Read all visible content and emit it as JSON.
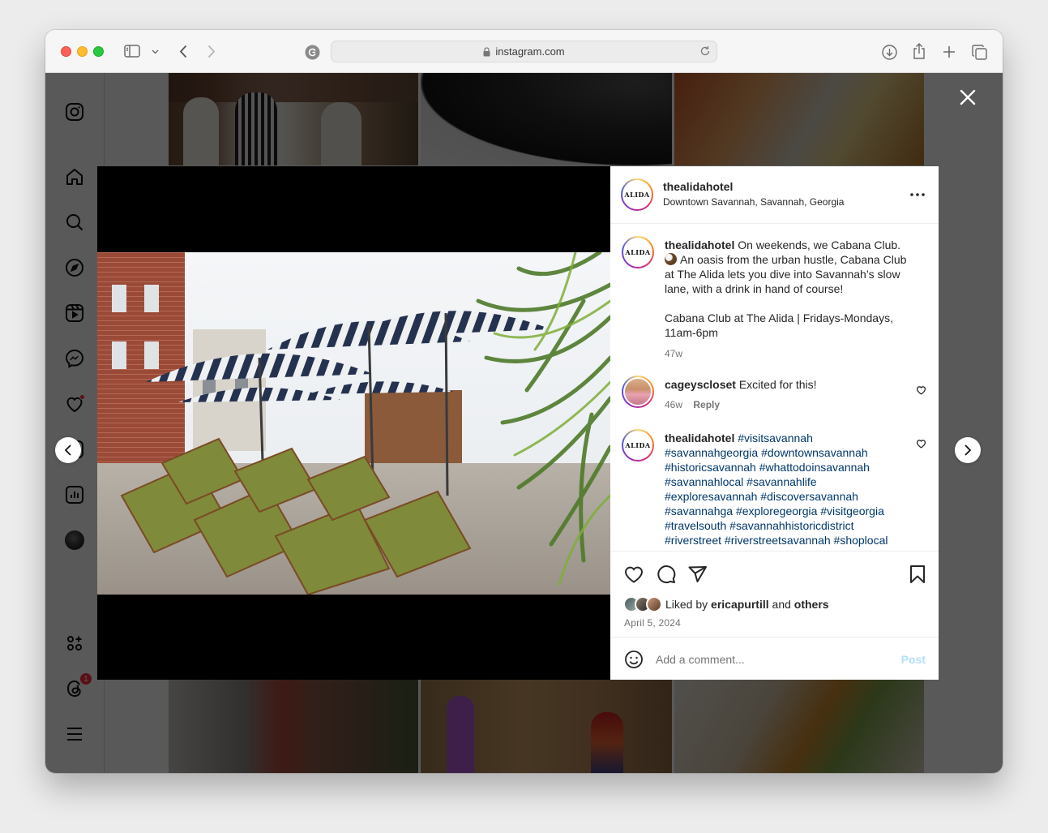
{
  "browser": {
    "url": "instagram.com"
  },
  "post": {
    "header": {
      "username": "thealidahotel",
      "location": "Downtown Savannah, Savannah, Georgia",
      "logo_text": "ALIDA"
    },
    "caption": {
      "username": "thealidahotel",
      "text_line1": "On weekends, we Cabana Club.",
      "text_line2": "An oasis from the urban hustle, Cabana Club at The Alida lets you dive into Savannah’s slow lane, with a drink in hand of course!",
      "text_line3": "Cabana Club at The Alida | Fridays-Mondays, 11am-6pm",
      "time": "47w"
    },
    "comments": [
      {
        "username": "cageyscloset",
        "text": "Excited for this!",
        "time": "46w",
        "reply": "Reply"
      },
      {
        "username": "thealidahotel",
        "hashtags": "#visitsavannah #savannahgeorgia #downtownsavannah #historicsavannah #whattodoinsavannah #savannahlocal #savannahlife #exploresavannah #discoversavannah #savannahga #exploregeorgia #visitgeorgia #travelsouth #savannahhistoricdistrict #riverstreet #riverstreetsavannah #shoplocal #savannahtravel"
      }
    ],
    "likes": {
      "prefix": "Liked by",
      "user": "ericapurtill",
      "middle": "and",
      "suffix": "others"
    },
    "date": "April 5, 2024",
    "add_comment": {
      "placeholder": "Add a comment...",
      "post_label": "Post"
    }
  },
  "sidebar": {
    "notification_count": "1"
  },
  "colors": {
    "link": "#00376b",
    "post_disabled": "#b2dffc",
    "badge": "#ff3040"
  }
}
